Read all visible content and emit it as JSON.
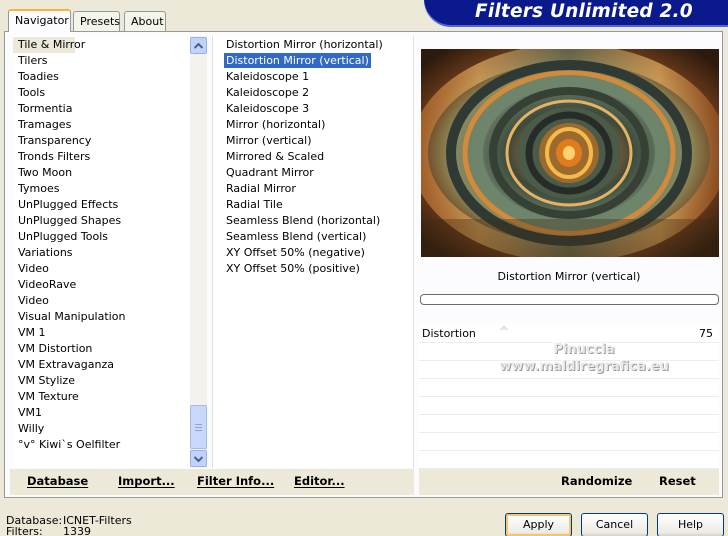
{
  "app": {
    "title": "Filters Unlimited 2.0"
  },
  "tabs": [
    {
      "label": "Navigator",
      "active": true
    },
    {
      "label": "Presets",
      "active": false
    },
    {
      "label": "About",
      "active": false
    }
  ],
  "categories": {
    "items": [
      "Tile & Mirror",
      "Tilers",
      "Toadies",
      "Tools",
      "Tormentia",
      "Tramages",
      "Transparency",
      "Tronds Filters",
      "Two Moon",
      "Tymoes",
      "UnPlugged Effects",
      "UnPlugged Shapes",
      "UnPlugged Tools",
      "Variations",
      "Video",
      "VideoRave",
      "Video",
      "Visual Manipulation",
      "VM 1",
      "VM Distortion",
      "VM Extravaganza",
      "VM Stylize",
      "VM Texture",
      "VM1",
      "Willy",
      "°v° Kiwi`s Oelfilter"
    ],
    "selected": "Tile & Mirror"
  },
  "filters": {
    "items": [
      "Distortion Mirror (horizontal)",
      "Distortion Mirror (vertical)",
      "Kaleidoscope 1",
      "Kaleidoscope 2",
      "Kaleidoscope 3",
      "Mirror (horizontal)",
      "Mirror (vertical)",
      "Mirrored & Scaled",
      "Quadrant Mirror",
      "Radial Mirror",
      "Radial Tile",
      "Seamless Blend (horizontal)",
      "Seamless Blend (vertical)",
      "XY Offset 50% (negative)",
      "XY Offset 50% (positive)"
    ],
    "selected": "Distortion Mirror (vertical)"
  },
  "preview": {
    "filter_name": "Distortion Mirror (vertical)",
    "progress": 0
  },
  "parameters": [
    {
      "name": "Distortion",
      "value": "75"
    }
  ],
  "watermark": {
    "line1": "Pinuccia",
    "line2": "www.maldiregrafica.eu"
  },
  "actions": {
    "database": "Database",
    "import": "Import...",
    "filter_info": "Filter Info...",
    "editor": "Editor...",
    "randomize": "Randomize",
    "reset": "Reset"
  },
  "status": {
    "database_label": "Database:",
    "database_value": "ICNET-Filters",
    "filters_label": "Filters:",
    "filters_value": "1339"
  },
  "buttons": {
    "apply": "Apply",
    "cancel": "Cancel",
    "help": "Help"
  },
  "colors": {
    "selection": "#316ac5",
    "banner": "#0a1a8c",
    "face": "#ece9d8",
    "active_tab_accent": "#f5b43f"
  }
}
